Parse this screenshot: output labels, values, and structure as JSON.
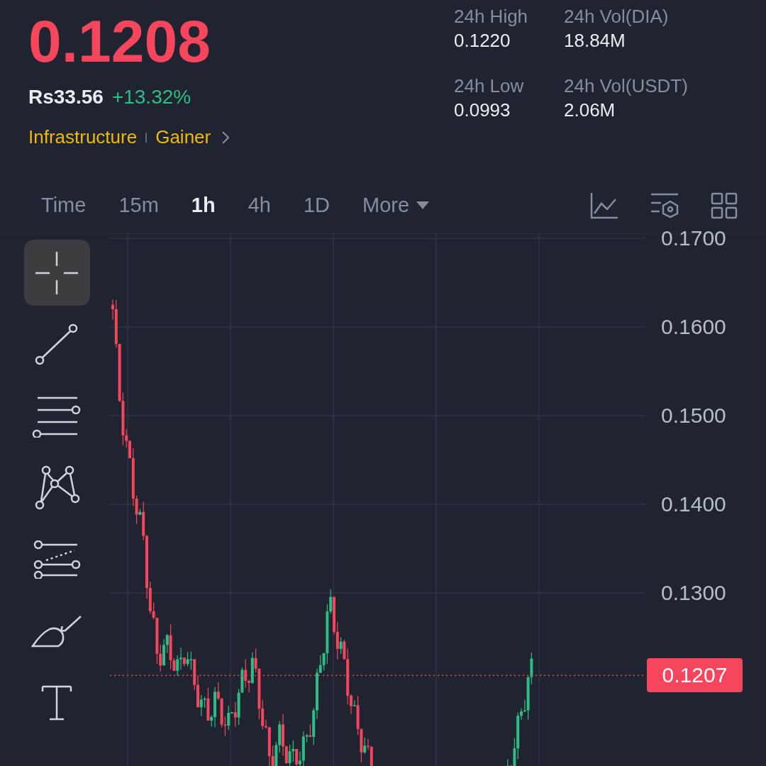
{
  "ticker": {
    "price": "0.1208",
    "fiat_price": "Rs33.56",
    "change": "+13.32%",
    "tags": [
      "Infrastructure",
      "Gainer"
    ]
  },
  "stats": [
    {
      "label": "24h High",
      "value": "0.1220"
    },
    {
      "label": "24h Vol(DIA)",
      "value": "18.84M"
    },
    {
      "label": "24h Low",
      "value": "0.0993"
    },
    {
      "label": "24h Vol(USDT)",
      "value": "2.06M"
    }
  ],
  "tabs": [
    {
      "label": "Time",
      "selected": false,
      "kind": "tab"
    },
    {
      "label": "15m",
      "selected": false,
      "kind": "tab"
    },
    {
      "label": "1h",
      "selected": true,
      "kind": "tab"
    },
    {
      "label": "4h",
      "selected": false,
      "kind": "tab"
    },
    {
      "label": "1D",
      "selected": false,
      "kind": "tab"
    },
    {
      "label": "More",
      "selected": false,
      "kind": "dropdown"
    }
  ],
  "tools": [
    {
      "kind": "crosshair",
      "selected": true
    },
    {
      "kind": "trendline",
      "selected": false
    },
    {
      "kind": "parallel",
      "selected": false
    },
    {
      "kind": "pattern",
      "selected": false
    },
    {
      "kind": "fib",
      "selected": false
    },
    {
      "kind": "brush",
      "selected": false
    },
    {
      "kind": "text",
      "selected": false
    }
  ],
  "price_axis": [
    "0.1700",
    "0.1600",
    "0.1500",
    "0.1400",
    "0.1300"
  ],
  "current_price": "0.1207"
}
